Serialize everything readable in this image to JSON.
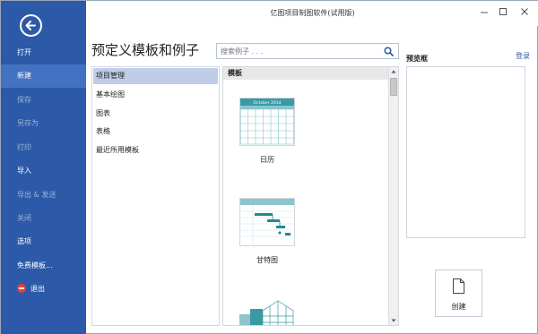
{
  "app": {
    "title": "亿图项目制图软件(试用版)",
    "login": "登录"
  },
  "sidebar": {
    "back_icon": "arrow-left-circle-icon",
    "items": [
      {
        "label": "打开",
        "state": "normal"
      },
      {
        "label": "新建",
        "state": "active"
      },
      {
        "label": "保存",
        "state": "disabled"
      },
      {
        "label": "另存为",
        "state": "disabled"
      },
      {
        "label": "打印",
        "state": "disabled"
      },
      {
        "label": "导入",
        "state": "normal"
      },
      {
        "label": "导出 & 发送",
        "state": "disabled"
      },
      {
        "label": "关闭",
        "state": "disabled"
      },
      {
        "label": "选项",
        "state": "normal"
      },
      {
        "label": "免费模板...",
        "state": "normal"
      },
      {
        "label": "退出",
        "state": "normal",
        "icon": "exit-icon"
      }
    ]
  },
  "main": {
    "title": "预定义模板和例子",
    "search": {
      "placeholder": "搜索例子 . . ."
    },
    "categories": [
      "项目管理",
      "基本绘图",
      "图表",
      "表格",
      "最近所用模板"
    ],
    "selected_category": "项目管理",
    "templates": {
      "header": "模板",
      "items": [
        {
          "label": "日历",
          "thumb_title": "October 2014"
        },
        {
          "label": "甘特图"
        }
      ]
    },
    "preview_label": "预览框",
    "create_label": "创建"
  },
  "colors": {
    "sidebar": "#2c5aa8",
    "sidebar_active": "#4372c2",
    "selection": "#bfcde9",
    "accent": "#3a9aa4"
  }
}
